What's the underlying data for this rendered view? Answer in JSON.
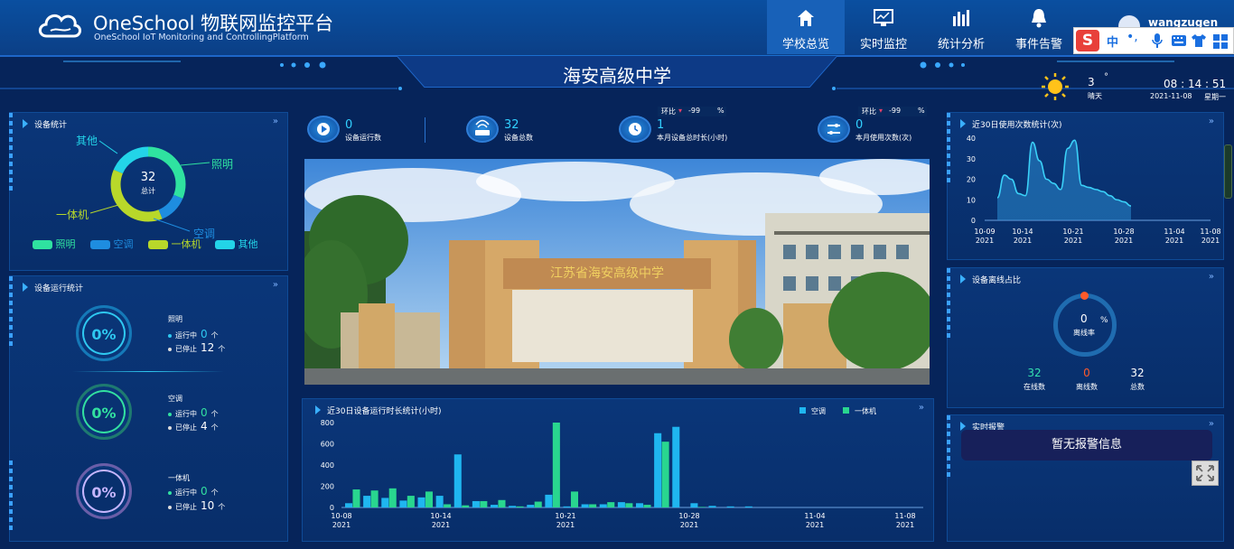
{
  "app": {
    "title_cn": "OneSchool 物联网监控平台",
    "title_en": "OneSchool IoT Monitoring and ControllingPlatform"
  },
  "nav": [
    {
      "label": "学校总览",
      "icon": "home-icon",
      "active": true
    },
    {
      "label": "实时监控",
      "icon": "monitor-icon",
      "active": false
    },
    {
      "label": "统计分析",
      "icon": "bar-chart-icon",
      "active": false
    },
    {
      "label": "事件告警",
      "icon": "bell-icon",
      "active": false
    }
  ],
  "user": {
    "name": "wangzugen"
  },
  "ime": {
    "mode": "中"
  },
  "school_name": "海安高级中学",
  "weather": {
    "temp": "3",
    "unit": "°",
    "desc": "晴天",
    "icon": "sun-icon"
  },
  "clock": {
    "time": "08 : 14 : 51",
    "date": "2021-11-08",
    "weekday": "星期一"
  },
  "device_stats": {
    "title": "设备统计",
    "total": "32",
    "total_label": "总计",
    "segments": [
      {
        "name": "照明",
        "value": 10,
        "color": "#2fe2a0"
      },
      {
        "name": "空调",
        "value": 4,
        "color": "#1e8de0"
      },
      {
        "name": "一体机",
        "value": 12,
        "color": "#b8d82a"
      },
      {
        "name": "其他",
        "value": 6,
        "color": "#23d4e8"
      }
    ]
  },
  "device_running": {
    "title": "设备运行统计",
    "groups": [
      {
        "name": "照明",
        "pct": "0%",
        "running_label": "运行中",
        "running": "0",
        "stopped_label": "已停止",
        "stopped": "12",
        "unit": "个",
        "color": "#2ec8f0",
        "dot": "#2ec8f0"
      },
      {
        "name": "空调",
        "pct": "0%",
        "running_label": "运行中",
        "running": "0",
        "stopped_label": "已停止",
        "stopped": "4",
        "unit": "个",
        "color": "#32e0a0",
        "dot": "#32e0a0"
      },
      {
        "name": "一体机",
        "pct": "0%",
        "running_label": "运行中",
        "running": "0",
        "stopped_label": "已停止",
        "stopped": "10",
        "unit": "个",
        "color": "#c6b6ff",
        "dot": "#c6b6ff"
      }
    ]
  },
  "stats_row": [
    {
      "value": "0",
      "label": "设备运行数",
      "icon": "play-icon"
    },
    {
      "value": "32",
      "label": "设备总数",
      "icon": "router-icon"
    },
    {
      "value": "1",
      "label": "本月设备总时长(小时)",
      "icon": "clock-icon",
      "yoy_label": "环比",
      "yoy_value": "-99",
      "yoy_unit": "%"
    },
    {
      "value": "0",
      "label": "本月使用次数(次)",
      "icon": "sliders-icon",
      "yoy_label": "环比",
      "yoy_value": "-99",
      "yoy_unit": "%"
    }
  ],
  "photo": {
    "gate_text": "江苏省海安高级中学"
  },
  "runtime_chart": {
    "title": "近30日设备运行时长统计(小时)",
    "legend": [
      {
        "name": "空调",
        "color": "#1fb6f0"
      },
      {
        "name": "一体机",
        "color": "#29d68f"
      }
    ]
  },
  "usage_chart": {
    "title": "近30日使用次数统计(次)"
  },
  "offline": {
    "title": "设备离线占比",
    "value": "0",
    "unit": "%",
    "label": "离线率",
    "online": "32",
    "online_label": "在线数",
    "offline": "0",
    "offline_label": "离线数",
    "total": "32",
    "total_label": "总数"
  },
  "alarms": {
    "title": "实时报警",
    "empty": "暂无报警信息"
  },
  "chart_data": [
    {
      "type": "bar",
      "title": "近30日设备运行时长统计(小时)",
      "ylim": [
        0,
        800
      ],
      "yticks": [
        0,
        200,
        400,
        600,
        800
      ],
      "xticks": [
        "10-08\n2021",
        "10-14\n2021",
        "10-21\n2021",
        "10-28\n2021",
        "11-04\n2021",
        "11-08\n2021"
      ],
      "x_start": "2021-10-08",
      "x_end": "2021-11-08",
      "dates": [
        "10-08",
        "10-09",
        "10-10",
        "10-11",
        "10-12",
        "10-13",
        "10-14",
        "10-15",
        "10-16",
        "10-17",
        "10-18",
        "10-19",
        "10-20",
        "10-21",
        "10-22",
        "10-23",
        "10-24",
        "10-25",
        "10-26",
        "10-27",
        "10-28",
        "10-29",
        "10-30",
        "10-31",
        "11-01",
        "11-02",
        "11-03",
        "11-04",
        "11-05",
        "11-06",
        "11-07"
      ],
      "series": [
        {
          "name": "空调",
          "values": [
            40,
            110,
            90,
            65,
            95,
            110,
            500,
            60,
            25,
            15,
            25,
            120,
            10,
            30,
            30,
            50,
            40,
            700,
            760,
            40,
            15,
            10,
            10,
            0,
            0,
            0,
            0,
            0,
            0,
            0,
            0
          ]
        },
        {
          "name": "一体机",
          "values": [
            170,
            160,
            180,
            110,
            150,
            30,
            20,
            60,
            70,
            10,
            55,
            870,
            150,
            30,
            50,
            40,
            25,
            620,
            0,
            5,
            0,
            0,
            0,
            0,
            0,
            0,
            0,
            0,
            0,
            0,
            0
          ]
        }
      ]
    },
    {
      "type": "area",
      "title": "近30日使用次数统计(次)",
      "ylim": [
        0,
        40
      ],
      "yticks": [
        0,
        10,
        20,
        30,
        40
      ],
      "xticks": [
        "10-09\n2021",
        "10-14\n2021",
        "10-21\n2021",
        "10-28\n2021",
        "11-04\n2021",
        "11-08\n2021"
      ],
      "x_start": "2021-10-09",
      "x_end": "2021-11-08",
      "dates": [
        "10-10",
        "10-11",
        "10-12",
        "10-13",
        "10-14",
        "10-15",
        "10-16",
        "10-17",
        "10-18",
        "10-19",
        "10-20",
        "10-21",
        "10-22",
        "10-23",
        "10-24",
        "10-25",
        "10-26",
        "10-27",
        "10-28",
        "10-29"
      ],
      "values": [
        11,
        22,
        20,
        13,
        12,
        38,
        29,
        20,
        18,
        15,
        35,
        39,
        17,
        16,
        15,
        14,
        12,
        10,
        9,
        7
      ]
    }
  ]
}
